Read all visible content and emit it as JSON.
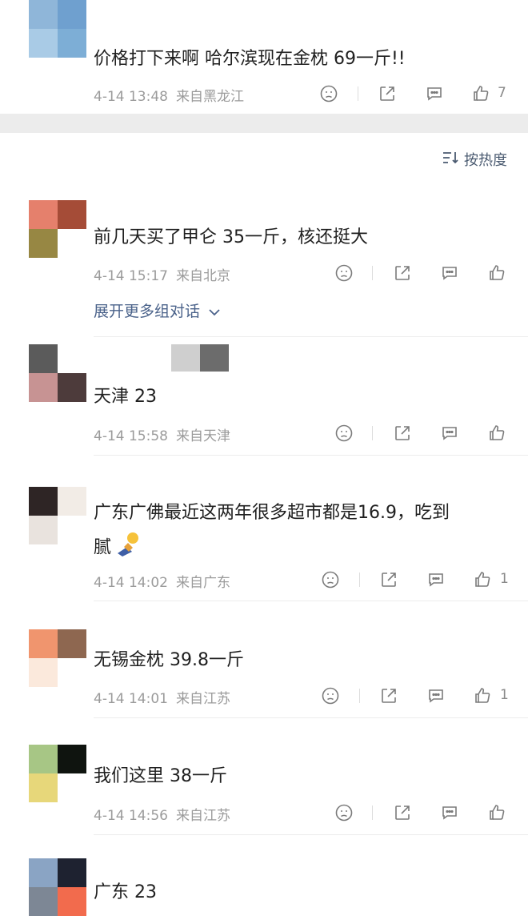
{
  "sort": {
    "label": "按热度",
    "icon": "sort-icon"
  },
  "expand_label": "展开更多组对话",
  "comments": [
    {
      "text": "价格打下来啊 哈尔滨现在金枕 69一斤!!",
      "date": "4-14 13:48",
      "location": "来自黑龙江",
      "likes": "7"
    },
    {
      "text": "前几天买了甲仑 35一斤，核还挺大",
      "date": "4-14 15:17",
      "location": "来自北京",
      "likes": ""
    },
    {
      "text": "天津 23",
      "date": "4-14 15:58",
      "location": "来自天津",
      "likes": ""
    },
    {
      "text": "广东广佛最近这两年很多超市都是16.9，吃到",
      "text2": "腻",
      "date": "4-14 14:02",
      "location": "来自广东",
      "likes": "1"
    },
    {
      "text": "无锡金枕 39.8一斤",
      "date": "4-14 14:01",
      "location": "来自江苏",
      "likes": "1"
    },
    {
      "text": "我们这里 38一斤",
      "date": "4-14 14:56",
      "location": "来自江苏",
      "likes": ""
    },
    {
      "text": "广东 23"
    }
  ],
  "icons": {
    "dislike": "dislike-face-icon",
    "share": "share-icon",
    "comment": "comment-icon",
    "like": "thumbs-up-icon",
    "emoji": "sleepy-emoji-icon"
  },
  "colors": {
    "text": "#1f1f1f",
    "meta": "#9b9b9b",
    "link": "#4a628a",
    "band": "#ececec"
  }
}
